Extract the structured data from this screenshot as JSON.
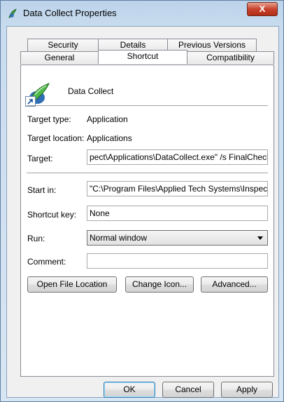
{
  "window": {
    "title": "Data Collect Properties",
    "close_label": "X"
  },
  "tabs": {
    "row1": [
      "Security",
      "Details",
      "Previous Versions"
    ],
    "row2": [
      "General",
      "Shortcut",
      "Compatibility"
    ]
  },
  "shortcut": {
    "name": "Data Collect",
    "target_type_label": "Target type:",
    "target_type_value": "Application",
    "target_location_label": "Target location:",
    "target_location_value": "Applications",
    "target_label": "Target:",
    "target_value": "pect\\Applications\\DataCollect.exe\" /s FinalCheck",
    "start_in_label": "Start in:",
    "start_in_value": "\"C:\\Program Files\\Applied Tech Systems\\Inspect\"",
    "shortcut_key_label": "Shortcut key:",
    "shortcut_key_value": "None",
    "run_label": "Run:",
    "run_value": "Normal window",
    "comment_label": "Comment:",
    "comment_value": ""
  },
  "buttons": {
    "open_file_location": "Open File Location",
    "change_icon": "Change Icon...",
    "advanced": "Advanced...",
    "ok": "OK",
    "cancel": "Cancel",
    "apply": "Apply"
  },
  "icons": {
    "app_icon": "data-collect-app-icon",
    "shortcut_arrow": "shortcut-arrow-icon"
  }
}
